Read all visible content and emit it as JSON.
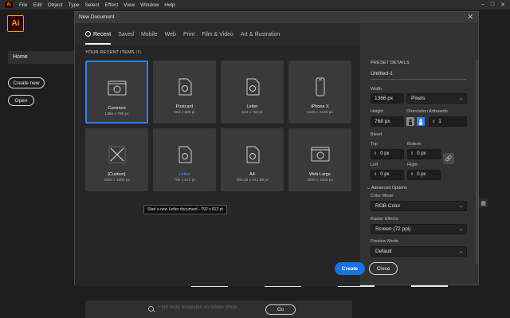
{
  "menubar": {
    "app_icon": "Ai",
    "items": [
      "File",
      "Edit",
      "Object",
      "Type",
      "Select",
      "Effect",
      "View",
      "Window",
      "Help"
    ]
  },
  "window_controls": {
    "minimize": "–",
    "maximize": "□",
    "close": "✕"
  },
  "app": {
    "logo": "Ai"
  },
  "home_sidebar": {
    "home": "Home",
    "create_new": "Create new",
    "open": "Open"
  },
  "dialog": {
    "title": "New Document",
    "close": "✕",
    "tabs": [
      "Recent",
      "Saved",
      "Mobile",
      "Web",
      "Print",
      "Film & Video",
      "Art & Illustration"
    ],
    "active_tab": "Recent",
    "recent_header": "YOUR RECENT ITEMS",
    "recent_count": "(8)",
    "presets": [
      {
        "name": "Common",
        "size": "1366 x 768 px",
        "icon": "web-icon",
        "selected": true
      },
      {
        "name": "Postcard",
        "size": "560 x 288 pt",
        "icon": "print-icon"
      },
      {
        "name": "Letter",
        "size": "612 x 792 pt",
        "icon": "print-icon"
      },
      {
        "name": "iPhone X",
        "size": "1125 x 2436 px",
        "icon": "mobile-icon"
      },
      {
        "name": "[Custom]",
        "size": "2000 x 1600 px",
        "icon": "art-icon"
      },
      {
        "name": "Letter",
        "size": "792 x 612 pt",
        "icon": "print-icon",
        "highlight": true
      },
      {
        "name": "A4",
        "size": "595.28 x 841.89 pt",
        "icon": "print-icon"
      },
      {
        "name": "Web-Large",
        "size": "1920 x 1080 px",
        "icon": "web-icon"
      }
    ],
    "tooltip": "Start a new Letter document - 792 x 612 pt",
    "search": {
      "placeholder": "Find more templates on Adobe Stock",
      "go": "Go"
    },
    "details": {
      "header": "PRESET DETAILS",
      "name": "Untitled-1",
      "width_label": "Width",
      "width_value": "1366 px",
      "units": "Pixels",
      "height_label": "Height",
      "height_value": "768 px",
      "orientation_label": "Orientation",
      "artboards_label": "Artboards",
      "artboards_value": "1",
      "bleed_label": "Bleed",
      "top_label": "Top",
      "top_value": "0 px",
      "bottom_label": "Bottom",
      "bottom_value": "0 px",
      "left_label": "Left",
      "left_value": "0 px",
      "right_label": "Right",
      "right_value": "0 px",
      "advanced": "Advanced Options",
      "color_mode_label": "Color Mode",
      "color_mode": "RGB Color",
      "raster_label": "Raster Effects",
      "raster": "Screen (72 ppi)",
      "preview_label": "Preview Mode",
      "preview": "Default"
    },
    "create": "Create",
    "close_button": "Close"
  },
  "colors": {
    "accent": "#1473e6",
    "brand": "#ff9a00",
    "selection": "#2d7ff9"
  }
}
